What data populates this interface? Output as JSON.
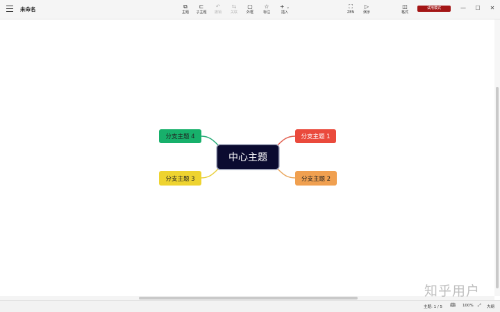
{
  "header": {
    "title": "未命名",
    "trial_label": "试用模式"
  },
  "toolbar": {
    "tools": [
      {
        "label": "主题",
        "icon": "topic-icon"
      },
      {
        "label": "子主题",
        "icon": "subtopic-icon"
      },
      {
        "label": "撤销",
        "icon": "undo-icon",
        "disabled": true
      },
      {
        "label": "关联",
        "icon": "relationship-icon",
        "disabled": true
      },
      {
        "label": "外框",
        "icon": "boundary-icon"
      },
      {
        "label": "标注",
        "icon": "marker-icon"
      },
      {
        "label": "插入",
        "icon": "insert-icon"
      }
    ],
    "zoom_label": "ZEN",
    "present_label": "演示",
    "format_label": "格式"
  },
  "mindmap": {
    "central": "中心主题",
    "branches": [
      {
        "label": "分支主题 1",
        "color": "#ea4a3c",
        "line": "#e05a4a"
      },
      {
        "label": "分支主题 2",
        "color": "#f0a050",
        "line": "#e9a55a"
      },
      {
        "label": "分支主题 3",
        "color": "#eed330",
        "line": "#e8cf3a"
      },
      {
        "label": "分支主题 4",
        "color": "#17b06b",
        "line": "#22a874"
      }
    ]
  },
  "status": {
    "topic_count": "主题: 1 / 5",
    "zoom": "100%",
    "outline": "大纲"
  },
  "watermark": "知乎用户"
}
